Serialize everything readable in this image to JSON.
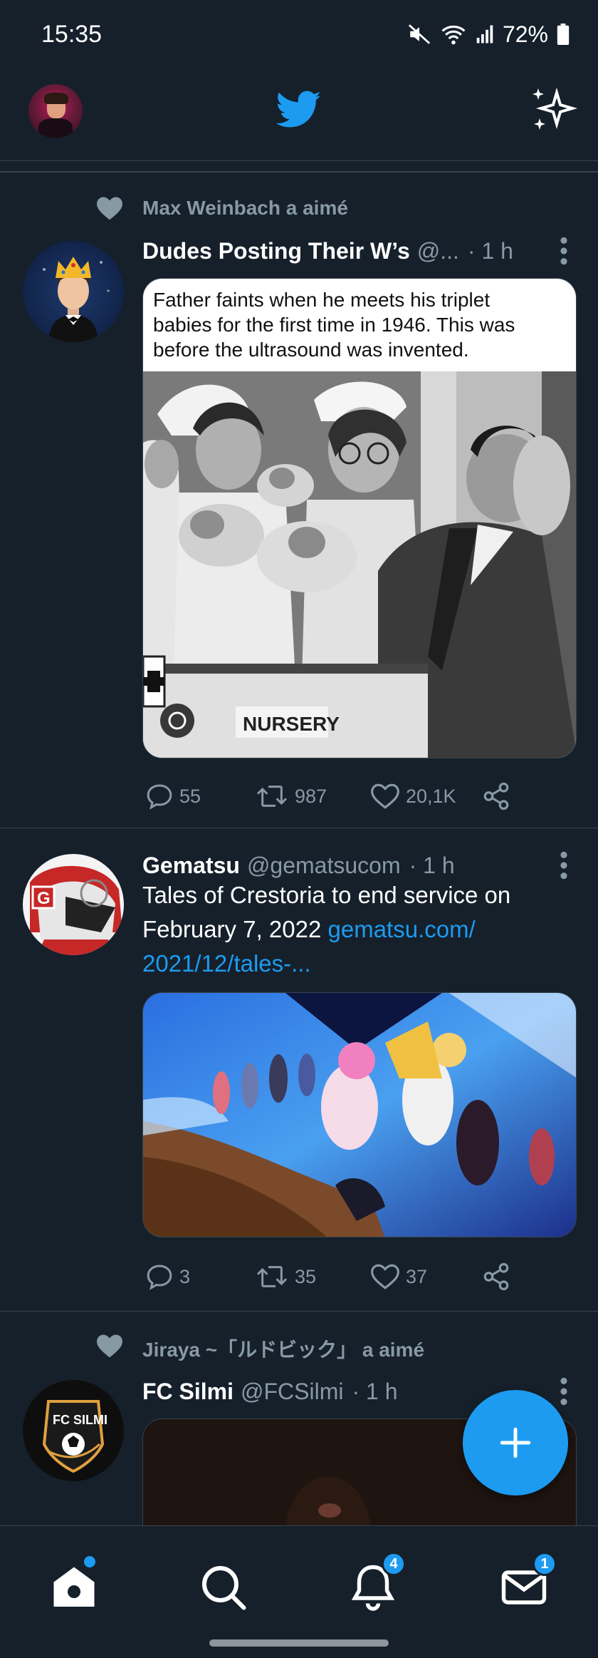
{
  "status_bar": {
    "time": "15:35",
    "battery": "72%"
  },
  "header": {
    "logo": "twitter-bird-icon",
    "sparkle": "sparkle-icon"
  },
  "tweets": [
    {
      "context": "Max Weinbach a aimé",
      "name": "Dudes Posting Their W’s",
      "handle": "@...",
      "time": "· 1 h",
      "media_caption": "Father faints when he meets his triplet babies for the first time in 1946. This was before the ultrasound was invented.",
      "media_sign": "NURSERY",
      "replies": "55",
      "retweets": "987",
      "likes": "20,1K"
    },
    {
      "name": "Gematsu",
      "handle": "@gematsucom",
      "time": "· 1 h",
      "text": "Tales of Crestoria to end service on February 7, 2022 ",
      "link": "gematsu.com/ 2021/12/tales-...",
      "replies": "3",
      "retweets": "35",
      "likes": "37"
    },
    {
      "context": "Jiraya ~「ルドビック」 a aimé",
      "name": "FC Silmi",
      "handle": "@FCSilmi",
      "time": "· 1 h",
      "avatar_text": "FC SILMI"
    }
  ],
  "bottom_nav": {
    "notifications_badge": "4",
    "messages_badge": "1"
  },
  "colors": {
    "background": "#15202b",
    "accent": "#1d9bf0",
    "muted": "#8899a6"
  }
}
